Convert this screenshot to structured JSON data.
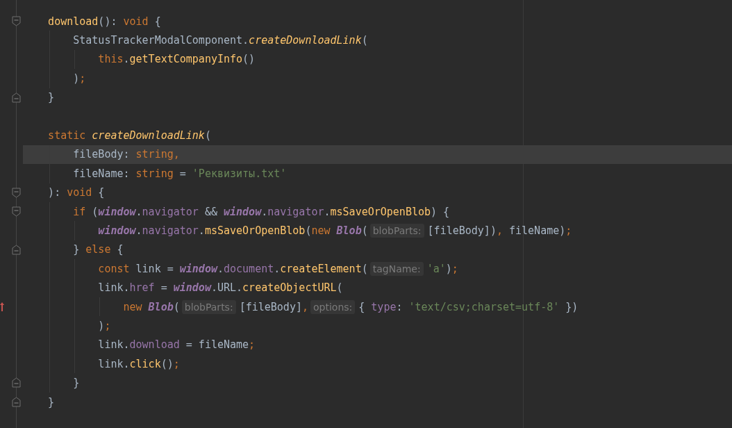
{
  "editor": {
    "lines": [
      {
        "kind": "fold_start",
        "current": false,
        "changed": false,
        "tokens": [
          {
            "kind": "fn",
            "text": "    download"
          },
          {
            "kind": "plain",
            "text": "():"
          },
          {
            "kind": "kw",
            "text": " void"
          },
          {
            "kind": "plain",
            "text": " {"
          }
        ]
      },
      {
        "kind": "plain",
        "current": false,
        "changed": false,
        "tokens": [
          {
            "kind": "plain",
            "text": "        StatusTrackerModalComponent."
          },
          {
            "kind": "fnItalic",
            "text": "createDownloadLink"
          },
          {
            "kind": "plain",
            "text": "("
          }
        ]
      },
      {
        "kind": "plain",
        "current": false,
        "changed": false,
        "tokens": [
          {
            "kind": "kw",
            "text": "            this"
          },
          {
            "kind": "plain",
            "text": "."
          },
          {
            "kind": "fn",
            "text": "getTextCompanyInfo"
          },
          {
            "kind": "plain",
            "text": "()"
          }
        ]
      },
      {
        "kind": "plain",
        "current": false,
        "changed": false,
        "tokens": [
          {
            "kind": "plain",
            "text": "        )"
          },
          {
            "kind": "kw",
            "text": ";"
          }
        ]
      },
      {
        "kind": "fold_end",
        "current": false,
        "changed": false,
        "tokens": [
          {
            "kind": "plain",
            "text": "    }"
          }
        ]
      },
      {
        "kind": "plain",
        "current": false,
        "changed": false
      },
      {
        "kind": "plain",
        "current": false,
        "changed": false,
        "tokens": [
          {
            "kind": "kw",
            "text": "    static"
          },
          {
            "kind": "fnItalic",
            "text": " createDownloadLink"
          },
          {
            "kind": "plain",
            "text": "("
          }
        ]
      },
      {
        "kind": "plain",
        "current": true,
        "changed": false,
        "tokens": [
          {
            "kind": "plain",
            "text": "        fileBody:"
          },
          {
            "kind": "kw",
            "text": " string,"
          }
        ]
      },
      {
        "kind": "plain",
        "current": false,
        "changed": false,
        "tokens": [
          {
            "kind": "plain",
            "text": "        fileName:"
          },
          {
            "kind": "kw",
            "text": " string"
          },
          {
            "kind": "plain",
            "text": " ="
          },
          {
            "kind": "str",
            "text": " 'Реквизиты.txt'"
          }
        ]
      },
      {
        "kind": "fold_start",
        "current": false,
        "changed": false,
        "tokens": [
          {
            "kind": "plain",
            "text": "    ):"
          },
          {
            "kind": "kw",
            "text": " void"
          },
          {
            "kind": "plain",
            "text": " {"
          }
        ]
      },
      {
        "kind": "fold_start",
        "current": false,
        "changed": false,
        "tokens": [
          {
            "kind": "kw",
            "text": "        if"
          },
          {
            "kind": "plain",
            "text": " ("
          },
          {
            "kind": "global",
            "text": "window"
          },
          {
            "kind": "plain",
            "text": "."
          },
          {
            "kind": "prop",
            "text": "navigator"
          },
          {
            "kind": "plain",
            "text": " && "
          },
          {
            "kind": "global",
            "text": "window"
          },
          {
            "kind": "plain",
            "text": "."
          },
          {
            "kind": "prop",
            "text": "navigator"
          },
          {
            "kind": "plain",
            "text": "."
          },
          {
            "kind": "fn",
            "text": "msSaveOrOpenBlob"
          },
          {
            "kind": "plain",
            "text": ") {"
          }
        ]
      },
      {
        "kind": "plain",
        "current": false,
        "changed": false,
        "tokens": [
          {
            "kind": "global",
            "text": "            window"
          },
          {
            "kind": "plain",
            "text": "."
          },
          {
            "kind": "prop",
            "text": "navigator"
          },
          {
            "kind": "plain",
            "text": "."
          },
          {
            "kind": "fn",
            "text": "msSaveOrOpenBlob"
          },
          {
            "kind": "plain",
            "text": "("
          },
          {
            "kind": "kw",
            "text": "new"
          },
          {
            "kind": "cls",
            "text": " Blob"
          },
          {
            "kind": "plain",
            "text": "("
          },
          {
            "kind": "hint",
            "text": "blobParts:"
          },
          {
            "kind": "plain",
            "text": "[fileBody])"
          },
          {
            "kind": "kw",
            "text": ","
          },
          {
            "kind": "plain",
            "text": " fileName)"
          },
          {
            "kind": "kw",
            "text": ";"
          }
        ]
      },
      {
        "kind": "fold_end",
        "current": false,
        "changed": false,
        "tokens": [
          {
            "kind": "plain",
            "text": "        }"
          },
          {
            "kind": "kw",
            "text": " else"
          },
          {
            "kind": "plain",
            "text": " {"
          }
        ]
      },
      {
        "kind": "plain",
        "current": false,
        "changed": false,
        "tokens": [
          {
            "kind": "kw",
            "text": "            const"
          },
          {
            "kind": "plain",
            "text": " link = "
          },
          {
            "kind": "global",
            "text": "window"
          },
          {
            "kind": "plain",
            "text": "."
          },
          {
            "kind": "prop",
            "text": "document"
          },
          {
            "kind": "plain",
            "text": "."
          },
          {
            "kind": "fn",
            "text": "createElement"
          },
          {
            "kind": "plain",
            "text": "("
          },
          {
            "kind": "hint",
            "text": "tagName:"
          },
          {
            "kind": "str",
            "text": "'a'"
          },
          {
            "kind": "plain",
            "text": ")"
          },
          {
            "kind": "kw",
            "text": ";"
          }
        ]
      },
      {
        "kind": "plain",
        "current": false,
        "changed": false,
        "tokens": [
          {
            "kind": "plain",
            "text": "            link."
          },
          {
            "kind": "prop",
            "text": "href"
          },
          {
            "kind": "plain",
            "text": " = "
          },
          {
            "kind": "global",
            "text": "window"
          },
          {
            "kind": "plain",
            "text": ".URL."
          },
          {
            "kind": "fn",
            "text": "createObjectURL"
          },
          {
            "kind": "plain",
            "text": "("
          }
        ]
      },
      {
        "kind": "plain",
        "current": false,
        "changed": true,
        "tokens": [
          {
            "kind": "kw",
            "text": "                new"
          },
          {
            "kind": "cls",
            "text": " Blob"
          },
          {
            "kind": "plain",
            "text": "("
          },
          {
            "kind": "hint",
            "text": "blobParts:"
          },
          {
            "kind": "plain",
            "text": "[fileBody]"
          },
          {
            "kind": "kw",
            "text": ","
          },
          {
            "kind": "hint",
            "text": "options:"
          },
          {
            "kind": "plain",
            "text": "{ "
          },
          {
            "kind": "prop",
            "text": "type"
          },
          {
            "kind": "plain",
            "text": ":"
          },
          {
            "kind": "str",
            "text": " 'text/csv;charset=utf-8'"
          },
          {
            "kind": "plain",
            "text": " })"
          }
        ]
      },
      {
        "kind": "plain",
        "current": false,
        "changed": false,
        "tokens": [
          {
            "kind": "plain",
            "text": "            )"
          },
          {
            "kind": "kw",
            "text": ";"
          }
        ]
      },
      {
        "kind": "plain",
        "current": false,
        "changed": false,
        "tokens": [
          {
            "kind": "plain",
            "text": "            link."
          },
          {
            "kind": "prop",
            "text": "download"
          },
          {
            "kind": "plain",
            "text": " = fileName"
          },
          {
            "kind": "kw",
            "text": ";"
          }
        ]
      },
      {
        "kind": "plain",
        "current": false,
        "changed": false,
        "tokens": [
          {
            "kind": "plain",
            "text": "            link."
          },
          {
            "kind": "fn",
            "text": "click"
          },
          {
            "kind": "plain",
            "text": "()"
          },
          {
            "kind": "kw",
            "text": ";"
          }
        ]
      },
      {
        "kind": "fold_end",
        "current": false,
        "changed": false,
        "tokens": [
          {
            "kind": "plain",
            "text": "        }"
          }
        ]
      },
      {
        "kind": "fold_end",
        "current": false,
        "changed": false,
        "tokens": [
          {
            "kind": "plain",
            "text": "    }"
          }
        ]
      }
    ]
  }
}
